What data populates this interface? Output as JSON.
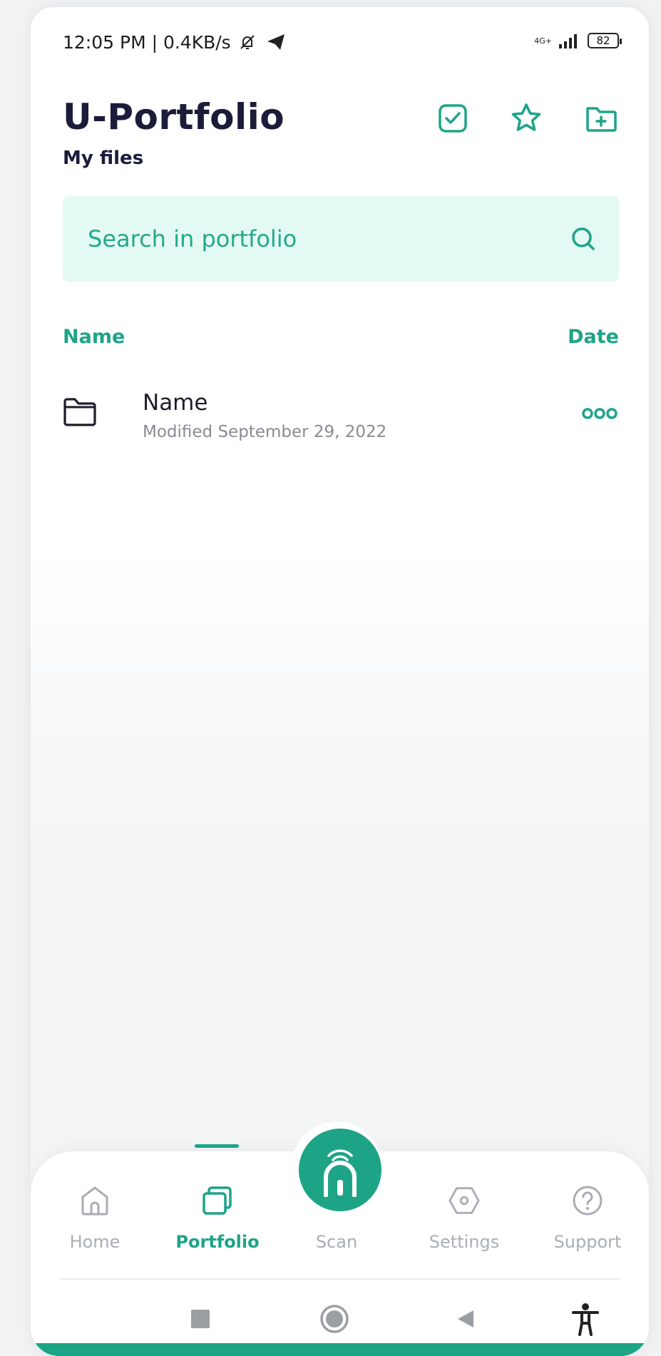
{
  "status_bar": {
    "time": "12:05 PM | 0.4KB/s",
    "network": "4G+",
    "battery": "82"
  },
  "header": {
    "title": "U-Portfolio",
    "subtitle": "My files",
    "actions": [
      "check-square-icon",
      "star-icon",
      "folder-add-icon"
    ]
  },
  "search": {
    "placeholder": "Search in portfolio"
  },
  "columns": {
    "name": "Name",
    "date": "Date"
  },
  "files": [
    {
      "name": "Name",
      "modified": "Modified September 29, 2022"
    }
  ],
  "nav": {
    "items": [
      {
        "label": "Home",
        "icon": "home-icon",
        "active": false
      },
      {
        "label": "Portfolio",
        "icon": "portfolio-icon",
        "active": true
      },
      {
        "label": "Scan",
        "icon": "scan-icon",
        "active": false
      },
      {
        "label": "Settings",
        "icon": "settings-icon",
        "active": false
      },
      {
        "label": "Support",
        "icon": "support-icon",
        "active": false
      }
    ]
  },
  "colors": {
    "accent": "#1da487",
    "search_bg": "#e3f9f4",
    "title": "#1b1c3a",
    "inactive": "#a9adb6"
  }
}
